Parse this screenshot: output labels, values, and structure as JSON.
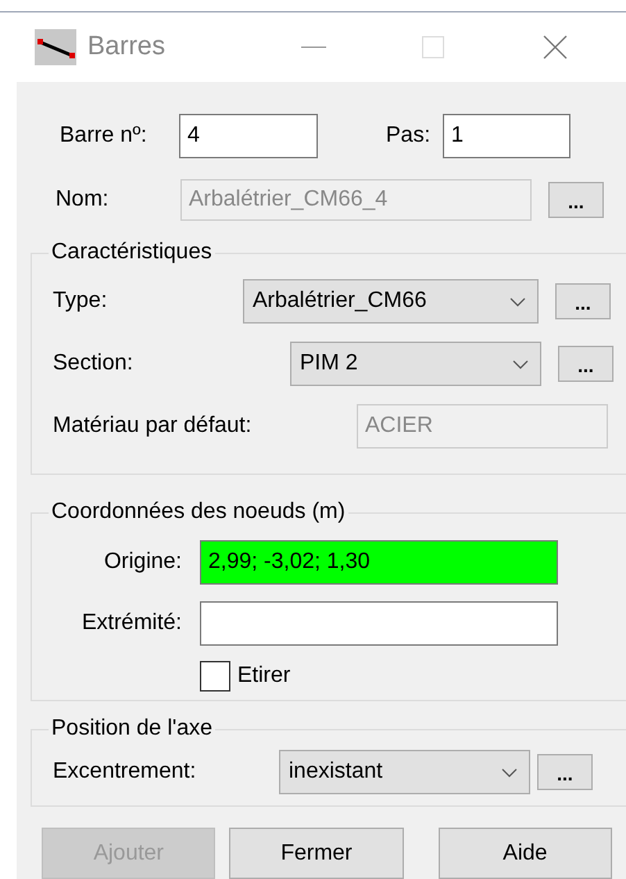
{
  "window": {
    "title": "Barres"
  },
  "bar_number": {
    "label": "Barre nº:",
    "value": "4"
  },
  "step": {
    "label": "Pas:",
    "value": "1"
  },
  "name": {
    "label": "Nom:",
    "value": "Arbalétrier_CM66_4",
    "disabled": true,
    "button": "..."
  },
  "characteristics": {
    "title": "Caractéristiques",
    "rows": [
      {
        "kind": "combo",
        "label": "Type:",
        "value": "Arbalétrier_CM66",
        "button": "..."
      },
      {
        "kind": "combo",
        "label": "Section:",
        "value": "PIM 2",
        "button": "..."
      },
      {
        "kind": "readonly",
        "label": "Matériau par défaut:",
        "value": "ACIER"
      }
    ]
  },
  "nodes": {
    "title": "Coordonnées des noeuds (m)",
    "rows": [
      {
        "label": "Origine:",
        "value": "2,99; -3,02; 1,30",
        "highlighted": true
      },
      {
        "label": "Extrémité:",
        "highlighted": false
      }
    ],
    "stretch": {
      "label": "Etirer",
      "checked": false
    }
  },
  "axis": {
    "title": "Position de l'axe",
    "label": "Excentrement:",
    "value": "inexistant",
    "button": "..."
  },
  "buttons": [
    {
      "label": "Ajouter",
      "disabled": true
    },
    {
      "label": "Fermer",
      "disabled": false
    },
    {
      "label": "Aide",
      "disabled": false
    }
  ]
}
